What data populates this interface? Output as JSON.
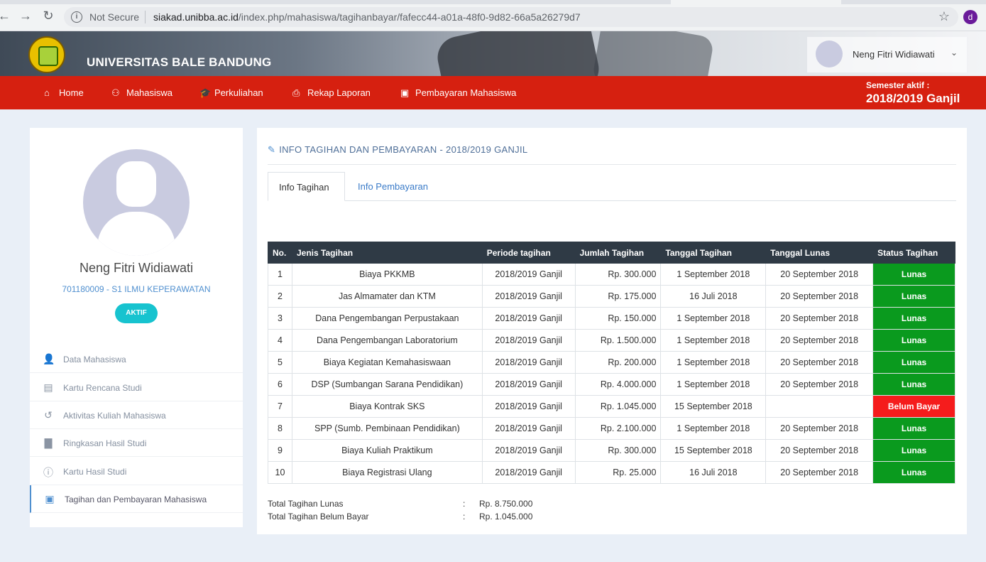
{
  "browser": {
    "security": "Not Secure",
    "url_host": "siakad.unibba.ac.id",
    "url_path": "/index.php/mahasiswa/tagihanbayar/fafecc44-a01a-48f0-9d82-66a5a26279d7",
    "profile_initial": "d"
  },
  "header": {
    "brand": "UNIVERSITAS BALE BANDUNG",
    "user_name": "Neng Fitri Widiawati"
  },
  "menu": {
    "items": [
      "Home",
      "Mahasiswa",
      "Perkuliahan",
      "Rekap Laporan",
      "Pembayaran Mahasiswa"
    ],
    "semester_label": "Semester aktif :",
    "semester_value": "2018/2019 Ganjil"
  },
  "profile": {
    "name": "Neng Fitri Widiawati",
    "id_prodi": "701180009 - S1 ILMU KEPERAWATAN",
    "status": "AKTIF"
  },
  "sidebar": {
    "items": [
      {
        "label": "Data Mahasiswa",
        "icon": "user-icon"
      },
      {
        "label": "Kartu Rencana Studi",
        "icon": "list-icon"
      },
      {
        "label": "Aktivitas Kuliah Mahasiswa",
        "icon": "history-icon"
      },
      {
        "label": "Ringkasan Hasil Studi",
        "icon": "file-icon"
      },
      {
        "label": "Kartu Hasil Studi",
        "icon": "info-icon"
      },
      {
        "label": "Tagihan dan Pembayaran Mahasiswa",
        "icon": "money-icon"
      }
    ]
  },
  "main": {
    "title": "INFO TAGIHAN DAN PEMBAYARAN - 2018/2019 GANJIL",
    "tabs": [
      "Info Tagihan",
      "Info Pembayaran"
    ],
    "columns": [
      "No.",
      "Jenis Tagihan",
      "Periode tagihan",
      "Jumlah Tagihan",
      "Tanggal Tagihan",
      "Tanggal Lunas",
      "Status Tagihan"
    ],
    "rows": [
      {
        "no": "1",
        "jenis": "Biaya PKKMB",
        "periode": "2018/2019 Ganjil",
        "jumlah": "Rp. 300.000",
        "tgl_tagihan": "1 September 2018",
        "tgl_lunas": "20 September 2018",
        "status": "Lunas"
      },
      {
        "no": "2",
        "jenis": "Jas Almamater dan KTM",
        "periode": "2018/2019 Ganjil",
        "jumlah": "Rp. 175.000",
        "tgl_tagihan": "16 Juli 2018",
        "tgl_lunas": "20 September 2018",
        "status": "Lunas"
      },
      {
        "no": "3",
        "jenis": "Dana Pengembangan Perpustakaan",
        "periode": "2018/2019 Ganjil",
        "jumlah": "Rp. 150.000",
        "tgl_tagihan": "1 September 2018",
        "tgl_lunas": "20 September 2018",
        "status": "Lunas"
      },
      {
        "no": "4",
        "jenis": "Dana Pengembangan Laboratorium",
        "periode": "2018/2019 Ganjil",
        "jumlah": "Rp. 1.500.000",
        "tgl_tagihan": "1 September 2018",
        "tgl_lunas": "20 September 2018",
        "status": "Lunas"
      },
      {
        "no": "5",
        "jenis": "Biaya Kegiatan Kemahasiswaan",
        "periode": "2018/2019 Ganjil",
        "jumlah": "Rp. 200.000",
        "tgl_tagihan": "1 September 2018",
        "tgl_lunas": "20 September 2018",
        "status": "Lunas"
      },
      {
        "no": "6",
        "jenis": "DSP (Sumbangan Sarana Pendidikan)",
        "periode": "2018/2019 Ganjil",
        "jumlah": "Rp. 4.000.000",
        "tgl_tagihan": "1 September 2018",
        "tgl_lunas": "20 September 2018",
        "status": "Lunas"
      },
      {
        "no": "7",
        "jenis": "Biaya Kontrak SKS",
        "periode": "2018/2019 Ganjil",
        "jumlah": "Rp. 1.045.000",
        "tgl_tagihan": "15 September 2018",
        "tgl_lunas": "",
        "status": "Belum Bayar"
      },
      {
        "no": "8",
        "jenis": "SPP (Sumb. Pembinaan Pendidikan)",
        "periode": "2018/2019 Ganjil",
        "jumlah": "Rp. 2.100.000",
        "tgl_tagihan": "1 September 2018",
        "tgl_lunas": "20 September 2018",
        "status": "Lunas"
      },
      {
        "no": "9",
        "jenis": "Biaya Kuliah Praktikum",
        "periode": "2018/2019 Ganjil",
        "jumlah": "Rp. 300.000",
        "tgl_tagihan": "15 September 2018",
        "tgl_lunas": "20 September 2018",
        "status": "Lunas"
      },
      {
        "no": "10",
        "jenis": "Biaya Registrasi Ulang",
        "periode": "2018/2019 Ganjil",
        "jumlah": "Rp. 25.000",
        "tgl_tagihan": "16 Juli 2018",
        "tgl_lunas": "20 September 2018",
        "status": "Lunas"
      }
    ],
    "totals": [
      {
        "label": "Total Tagihan Lunas",
        "value": "Rp. 8.750.000"
      },
      {
        "label": "Total Tagihan Belum Bayar",
        "value": "Rp. 1.045.000"
      }
    ]
  },
  "colors": {
    "menu_red": "#d62010",
    "lunas_green": "#0a9a1e",
    "belum_red": "#f51c1c",
    "table_head": "#2f3a45",
    "badge_cyan": "#17c3cf"
  }
}
